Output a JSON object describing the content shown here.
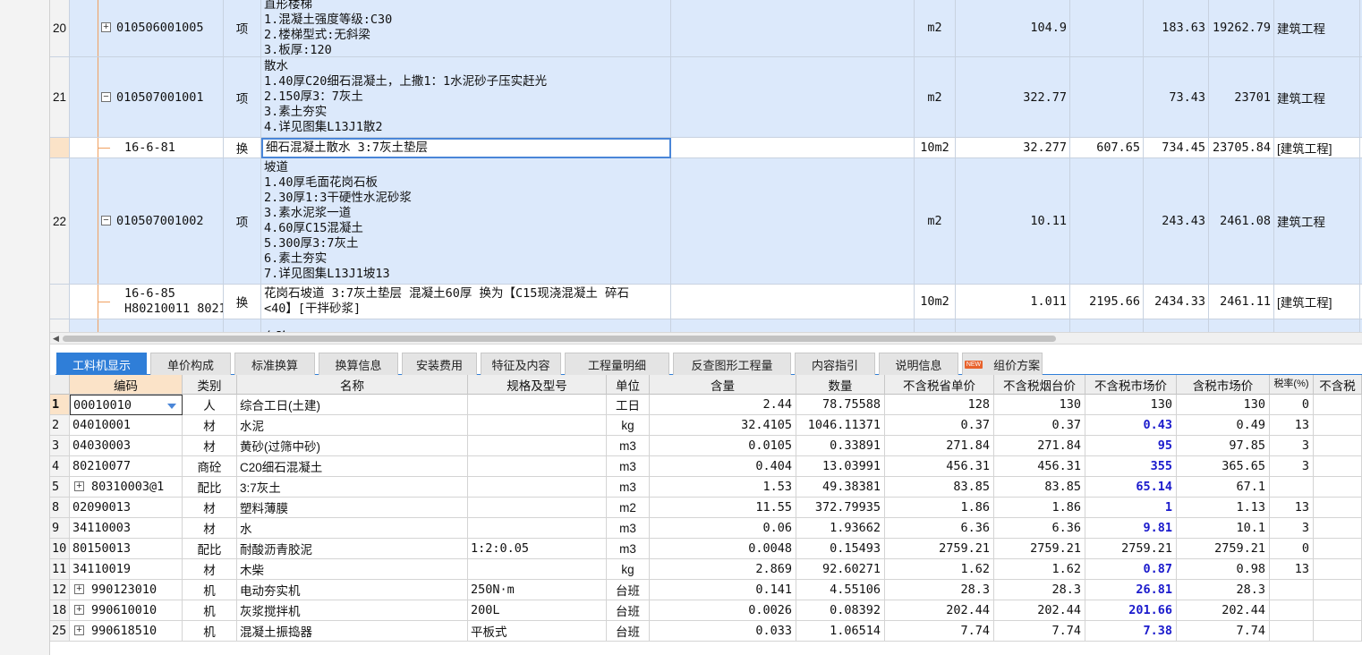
{
  "upper_rows": [
    {
      "type": "item",
      "num": "20",
      "code": "010506001005",
      "kind": "项",
      "desc": [
        "直形楼梯",
        "1.混凝土强度等级:C30",
        "2.楼梯型式:无斜梁",
        "3.板厚:120"
      ],
      "unit": "m2",
      "qty": "104.9",
      "price": "",
      "combined": "183.63",
      "total": "19262.79",
      "cat": "建筑工程",
      "expanded": false
    },
    {
      "type": "item",
      "num": "21",
      "code": "010507001001",
      "kind": "项",
      "desc": [
        "散水",
        "1.40厚C20细石混凝土，上撒1：1水泥砂子压实赶光",
        "2.150厚3：7灰土",
        "3.素土夯实",
        "4.详见图集L13J1散2"
      ],
      "unit": "m2",
      "qty": "322.77",
      "price": "",
      "combined": "73.43",
      "total": "23701",
      "cat": "建筑工程",
      "expanded": true
    },
    {
      "type": "sub",
      "num": "",
      "code": "16-6-81",
      "kind": "换",
      "desc": [
        "细石混凝土散水 3:7灰土垫层"
      ],
      "unit": "10m2",
      "qty": "32.277",
      "price": "607.65",
      "combined": "734.45",
      "total": "23705.84",
      "cat": "[建筑工程]"
    },
    {
      "type": "item",
      "num": "22",
      "code": "010507001002",
      "kind": "项",
      "desc": [
        "坡道",
        "1.40厚毛面花岗石板",
        "2.30厚1:3干硬性水泥砂浆",
        "3.素水泥浆一道",
        "4.60厚C15混凝土",
        "5.300厚3:7灰土",
        "6.素土夯实",
        "7.详见图集L13J1坡13"
      ],
      "unit": "m2",
      "qty": "10.11",
      "price": "",
      "combined": "243.43",
      "total": "2461.08",
      "cat": "建筑工程",
      "expanded": true
    },
    {
      "type": "sub",
      "num": "",
      "code": "16-6-85",
      "code2": "H80210011 8021…",
      "kind": "换",
      "desc": [
        "花岗石坡道 3:7灰土垫层 混凝土60厚  换为【C15现浇混凝土 碎石",
        "<40】[干拌砂浆]"
      ],
      "unit": "10m2",
      "qty": "1.011",
      "price": "2195.66",
      "combined": "2434.33",
      "total": "2461.11",
      "cat": "[建筑工程]"
    },
    {
      "type": "item",
      "num": "",
      "code": "",
      "kind": "",
      "desc": [
        "台阶"
      ],
      "unit": "",
      "qty": "",
      "price": "",
      "combined": "",
      "total": "",
      "cat": ""
    }
  ],
  "tabs": [
    {
      "label": "工料机显示",
      "active": true
    },
    {
      "label": "单价构成"
    },
    {
      "label": "标准换算"
    },
    {
      "label": "换算信息"
    },
    {
      "label": "安装费用"
    },
    {
      "label": "特征及内容"
    },
    {
      "label": "工程量明细"
    },
    {
      "label": "反查图形工程量"
    },
    {
      "label": "内容指引"
    },
    {
      "label": "说明信息"
    },
    {
      "label": "组价方案",
      "badge": "NEW"
    }
  ],
  "lower_headers": [
    "编码",
    "类别",
    "名称",
    "规格及型号",
    "单位",
    "含量",
    "数量",
    "不含税省单价",
    "不含税烟台价",
    "不含税市场价",
    "含税市场价",
    "税率(%)",
    "不含税"
  ],
  "lower_rows": [
    {
      "num": "1",
      "code": "00010010",
      "type": "人",
      "name": "综合工日(土建)",
      "spec": "",
      "unit": "工日",
      "content": "2.44",
      "qty": "78.75588",
      "prov": "128",
      "yt": "130",
      "mkt": "130",
      "mkt_tax": "130",
      "rate": "0",
      "expand": false,
      "mkt_blue": false
    },
    {
      "num": "2",
      "code": "04010001",
      "type": "材",
      "name": "水泥",
      "spec": "",
      "unit": "kg",
      "content": "32.4105",
      "qty": "1046.11371",
      "prov": "0.37",
      "yt": "0.37",
      "mkt": "0.43",
      "mkt_tax": "0.49",
      "rate": "13",
      "expand": false,
      "mkt_blue": true
    },
    {
      "num": "3",
      "code": "04030003",
      "type": "材",
      "name": "黄砂(过筛中砂)",
      "spec": "",
      "unit": "m3",
      "content": "0.0105",
      "qty": "0.33891",
      "prov": "271.84",
      "yt": "271.84",
      "mkt": "95",
      "mkt_tax": "97.85",
      "rate": "3",
      "expand": false,
      "mkt_blue": true
    },
    {
      "num": "4",
      "code": "80210077",
      "type": "商砼",
      "name": "C20细石混凝土",
      "spec": "",
      "unit": "m3",
      "content": "0.404",
      "qty": "13.03991",
      "prov": "456.31",
      "yt": "456.31",
      "mkt": "355",
      "mkt_tax": "365.65",
      "rate": "3",
      "expand": false,
      "mkt_blue": true
    },
    {
      "num": "5",
      "code": "80310003@1",
      "type": "配比",
      "name": "3:7灰土",
      "spec": "",
      "unit": "m3",
      "content": "1.53",
      "qty": "49.38381",
      "prov": "83.85",
      "yt": "83.85",
      "mkt": "65.14",
      "mkt_tax": "67.1",
      "rate": "",
      "expand": true,
      "mkt_blue": true
    },
    {
      "num": "8",
      "code": "02090013",
      "type": "材",
      "name": "塑料薄膜",
      "spec": "",
      "unit": "m2",
      "content": "11.55",
      "qty": "372.79935",
      "prov": "1.86",
      "yt": "1.86",
      "mkt": "1",
      "mkt_tax": "1.13",
      "rate": "13",
      "expand": false,
      "mkt_blue": true
    },
    {
      "num": "9",
      "code": "34110003",
      "type": "材",
      "name": "水",
      "spec": "",
      "unit": "m3",
      "content": "0.06",
      "qty": "1.93662",
      "prov": "6.36",
      "yt": "6.36",
      "mkt": "9.81",
      "mkt_tax": "10.1",
      "rate": "3",
      "expand": false,
      "mkt_blue": true
    },
    {
      "num": "10",
      "code": "80150013",
      "type": "配比",
      "name": "耐酸沥青胶泥",
      "spec": "1:2:0.05",
      "unit": "m3",
      "content": "0.0048",
      "qty": "0.15493",
      "prov": "2759.21",
      "yt": "2759.21",
      "mkt": "2759.21",
      "mkt_tax": "2759.21",
      "rate": "0",
      "expand": false,
      "mkt_blue": false
    },
    {
      "num": "11",
      "code": "34110019",
      "type": "材",
      "name": "木柴",
      "spec": "",
      "unit": "kg",
      "content": "2.869",
      "qty": "92.60271",
      "prov": "1.62",
      "yt": "1.62",
      "mkt": "0.87",
      "mkt_tax": "0.98",
      "rate": "13",
      "expand": false,
      "mkt_blue": true
    },
    {
      "num": "12",
      "code": "990123010",
      "type": "机",
      "name": "电动夯实机",
      "spec": "250N·m",
      "unit": "台班",
      "content": "0.141",
      "qty": "4.55106",
      "prov": "28.3",
      "yt": "28.3",
      "mkt": "26.81",
      "mkt_tax": "28.3",
      "rate": "",
      "expand": true,
      "mkt_blue": true
    },
    {
      "num": "18",
      "code": "990610010",
      "type": "机",
      "name": "灰浆搅拌机",
      "spec": "200L",
      "unit": "台班",
      "content": "0.0026",
      "qty": "0.08392",
      "prov": "202.44",
      "yt": "202.44",
      "mkt": "201.66",
      "mkt_tax": "202.44",
      "rate": "",
      "expand": true,
      "mkt_blue": true
    },
    {
      "num": "25",
      "code": "990618510",
      "type": "机",
      "name": "混凝土振捣器",
      "spec": "平板式",
      "unit": "台班",
      "content": "0.033",
      "qty": "1.06514",
      "prov": "7.74",
      "yt": "7.74",
      "mkt": "7.38",
      "mkt_tax": "7.74",
      "rate": "",
      "expand": true,
      "mkt_blue": true
    }
  ]
}
